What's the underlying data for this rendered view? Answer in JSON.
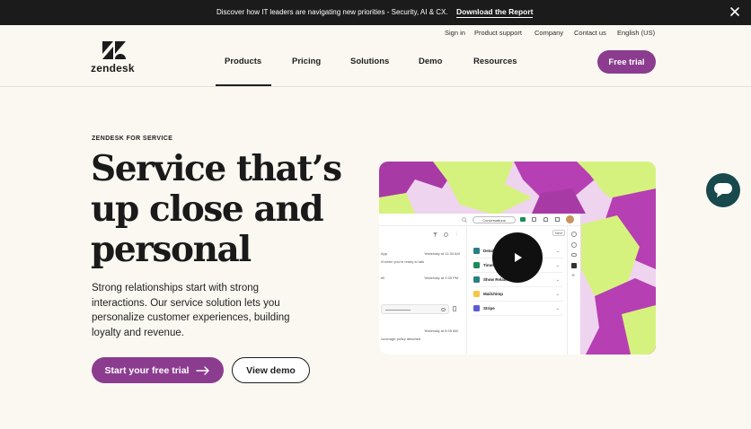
{
  "announcement": {
    "message": "Discover how IT leaders are navigating new priorities - Security, AI & CX.",
    "link": "Download the Report"
  },
  "utility_nav": [
    "Sign in",
    "Product support",
    "Company",
    "Contact us",
    "English (US)"
  ],
  "brand": {
    "name": "zendesk"
  },
  "main_nav": [
    "Products",
    "Pricing",
    "Solutions",
    "Demo",
    "Resources"
  ],
  "header": {
    "cta": "Free trial"
  },
  "hero": {
    "eyebrow": "ZENDESK FOR SERVICE",
    "title_lines": [
      "Service that’s",
      "up close and",
      "personal"
    ],
    "description": "Strong relationships start with strong interactions. Our service solution lets you personalize customer experiences, building loyalty and revenue.",
    "primary_cta": "Start your free trial",
    "secondary_cta": "View demo"
  },
  "app_preview": {
    "tab": "Conversations",
    "left_snippets": [
      {
        "name": "App",
        "time": "Yesterday at 11:30 AM",
        "text": "ill when you're ready to talk"
      },
      {
        "name": "ell",
        "time": "Yesterday at 2:45 PM",
        "text": ""
      },
      {
        "name": "",
        "time": "Yesterday at 8:45 AM",
        "text": "coverage policy attached"
      }
    ],
    "apps": [
      "Details",
      "Timeline",
      "Show Related Tickets",
      "Mailchimp",
      "Stripe"
    ],
    "next_label": "Next"
  },
  "colors": {
    "brand_purple": "#8c3c8f",
    "chat_fab": "#17494d",
    "announcement_bg": "#1b1b1b",
    "page_bg": "#fbf8f2"
  }
}
